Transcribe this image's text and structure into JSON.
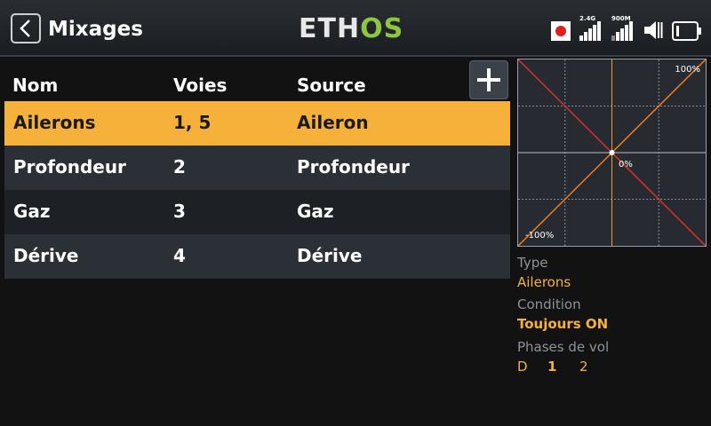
{
  "header": {
    "title": "Mixages",
    "logo_part1": "ETH",
    "logo_part2": "OS",
    "signal1_label": "2.4G",
    "signal2_label": "900M"
  },
  "table": {
    "columns": [
      "Nom",
      "Voies",
      "Source"
    ],
    "rows": [
      {
        "nom": "Ailerons",
        "voies": "1, 5",
        "source": "Aileron"
      },
      {
        "nom": "Profondeur",
        "voies": "2",
        "source": "Profondeur"
      },
      {
        "nom": "Gaz",
        "voies": "3",
        "source": "Gaz"
      },
      {
        "nom": "Dérive",
        "voies": "4",
        "source": "Dérive"
      }
    ]
  },
  "graph": {
    "label_max": "100%",
    "label_center": "0%",
    "label_min": "-100%"
  },
  "details": {
    "type_label": "Type",
    "type_value": "Ailerons",
    "condition_label": "Condition",
    "condition_value": "Toujours ON",
    "phases_label": "Phases de vol",
    "phases": [
      "D",
      "1",
      "2"
    ]
  },
  "colors": {
    "accent": "#f6b13b",
    "logo_green": "#8dc63f",
    "curve_orange": "#f07f1a",
    "curve_red": "#d9332b"
  }
}
